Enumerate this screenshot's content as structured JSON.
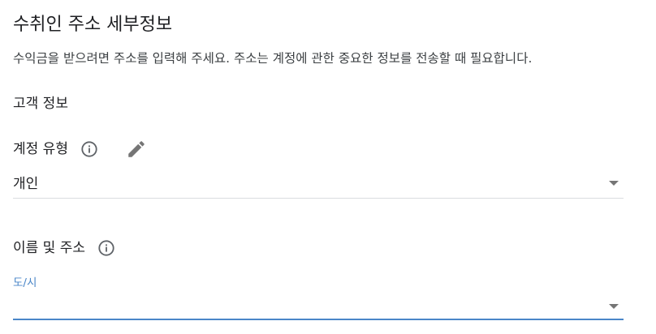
{
  "page": {
    "title": "수취인 주소 세부정보",
    "description": "수익금을 받으려면 주소를 입력해 주세요. 주소는 계정에 관한 중요한 정보를 전송할 때 필요합니다."
  },
  "customer_info": {
    "heading": "고객 정보",
    "account_type": {
      "label": "계정 유형",
      "value": "개인",
      "info_icon": "info-icon",
      "edit_icon": "pencil-icon"
    }
  },
  "name_address": {
    "label": "이름 및 주소",
    "info_icon": "info-icon",
    "city": {
      "label": "도/시",
      "value": ""
    }
  },
  "colors": {
    "accent": "#4a86c8",
    "icon": "#757575",
    "divider": "#dadce0"
  }
}
